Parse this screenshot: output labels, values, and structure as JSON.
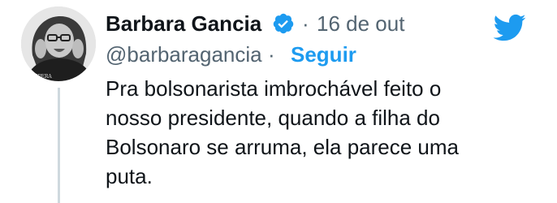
{
  "tweet": {
    "author_name": "Barbara Gancia",
    "separator": "·",
    "date": "16 de out",
    "handle": "@barbaragancia",
    "follow_label": "Seguir",
    "text_lines": [
      "Pra bolsonarista imbrochável feito o",
      "nosso presidente, quando a filha do",
      "Bolsonaro se arruma, ela parece uma",
      "puta."
    ],
    "avatar_shirt_text": "AMPERA"
  },
  "icons": {
    "verified": "verified-badge-icon",
    "brand": "twitter-bird-icon"
  },
  "colors": {
    "accent": "#1d9bf0",
    "secondary_text": "#536471",
    "primary_text": "#0f1419",
    "thread_line": "#cfd9de"
  }
}
